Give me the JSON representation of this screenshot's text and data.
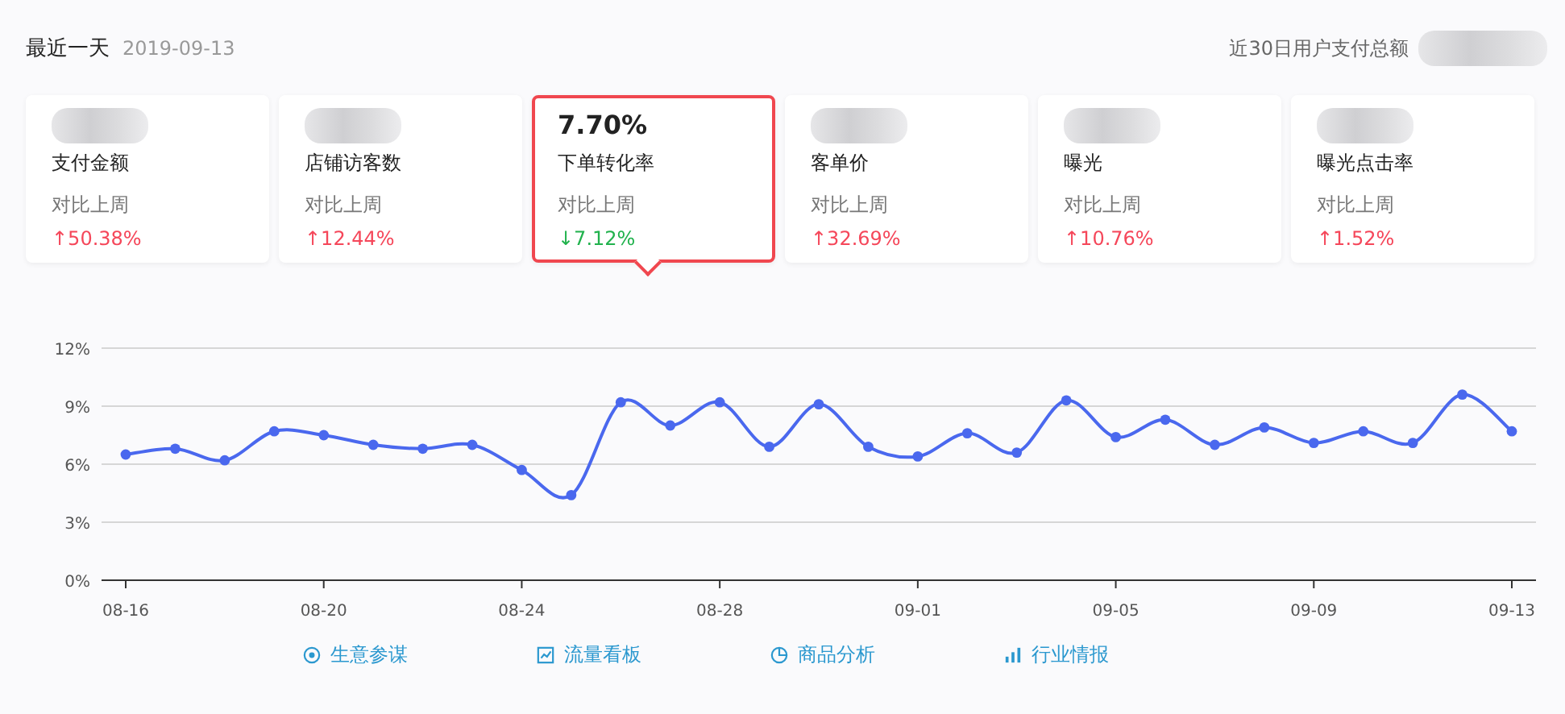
{
  "header": {
    "title": "最近一天",
    "date": "2019-09-13",
    "total_label": "近30日用户支付总额"
  },
  "cards": [
    {
      "label": "支付金额",
      "compare_label": "对比上周",
      "change": "↑50.38%",
      "kind": "rise",
      "selected": false
    },
    {
      "label": "店铺访客数",
      "compare_label": "对比上周",
      "change": "↑12.44%",
      "kind": "rise",
      "selected": false
    },
    {
      "value": "7.70%",
      "label": "下单转化率",
      "compare_label": "对比上周",
      "change": "↓7.12%",
      "kind": "fall",
      "selected": true
    },
    {
      "label": "客单价",
      "compare_label": "对比上周",
      "change": "↑32.69%",
      "kind": "rise",
      "selected": false
    },
    {
      "label": "曝光",
      "compare_label": "对比上周",
      "change": "↑10.76%",
      "kind": "rise",
      "selected": false
    },
    {
      "label": "曝光点击率",
      "compare_label": "对比上周",
      "change": "↑1.52%",
      "kind": "rise",
      "selected": false
    }
  ],
  "chart": {
    "chart_data": {
      "type": "line",
      "categories": [
        "08-16",
        null,
        null,
        null,
        "08-20",
        null,
        null,
        null,
        "08-24",
        null,
        null,
        null,
        "08-28",
        null,
        null,
        null,
        "09-01",
        null,
        null,
        null,
        "09-05",
        null,
        null,
        null,
        "09-09",
        null,
        null,
        null,
        "09-13"
      ],
      "grid": true,
      "series": [
        {
          "color": "#4a68ee",
          "marker": "circle",
          "values": [
            6.5,
            6.8,
            6.2,
            7.7,
            7.5,
            7.0,
            6.8,
            7.0,
            5.7,
            4.4,
            9.2,
            8.0,
            9.2,
            6.9,
            9.1,
            6.9,
            6.4,
            7.6,
            6.6,
            9.3,
            7.4,
            8.3,
            7.0,
            7.9,
            7.1,
            7.7,
            7.1,
            9.6,
            7.7
          ]
        }
      ],
      "ylim": [
        0,
        12
      ],
      "yticks": [
        {
          "value": 0,
          "label": "0%"
        },
        {
          "value": 3,
          "label": "3%"
        },
        {
          "value": 6,
          "label": "6%"
        },
        {
          "value": 9,
          "label": "9%"
        },
        {
          "value": 12,
          "label": "12%"
        }
      ]
    }
  },
  "links": [
    {
      "label": "生意参谋",
      "kind": "target"
    },
    {
      "label": "流量看板",
      "kind": "board"
    },
    {
      "label": "商品分析",
      "kind": "pie"
    },
    {
      "label": "行业情报",
      "kind": "bars"
    }
  ]
}
